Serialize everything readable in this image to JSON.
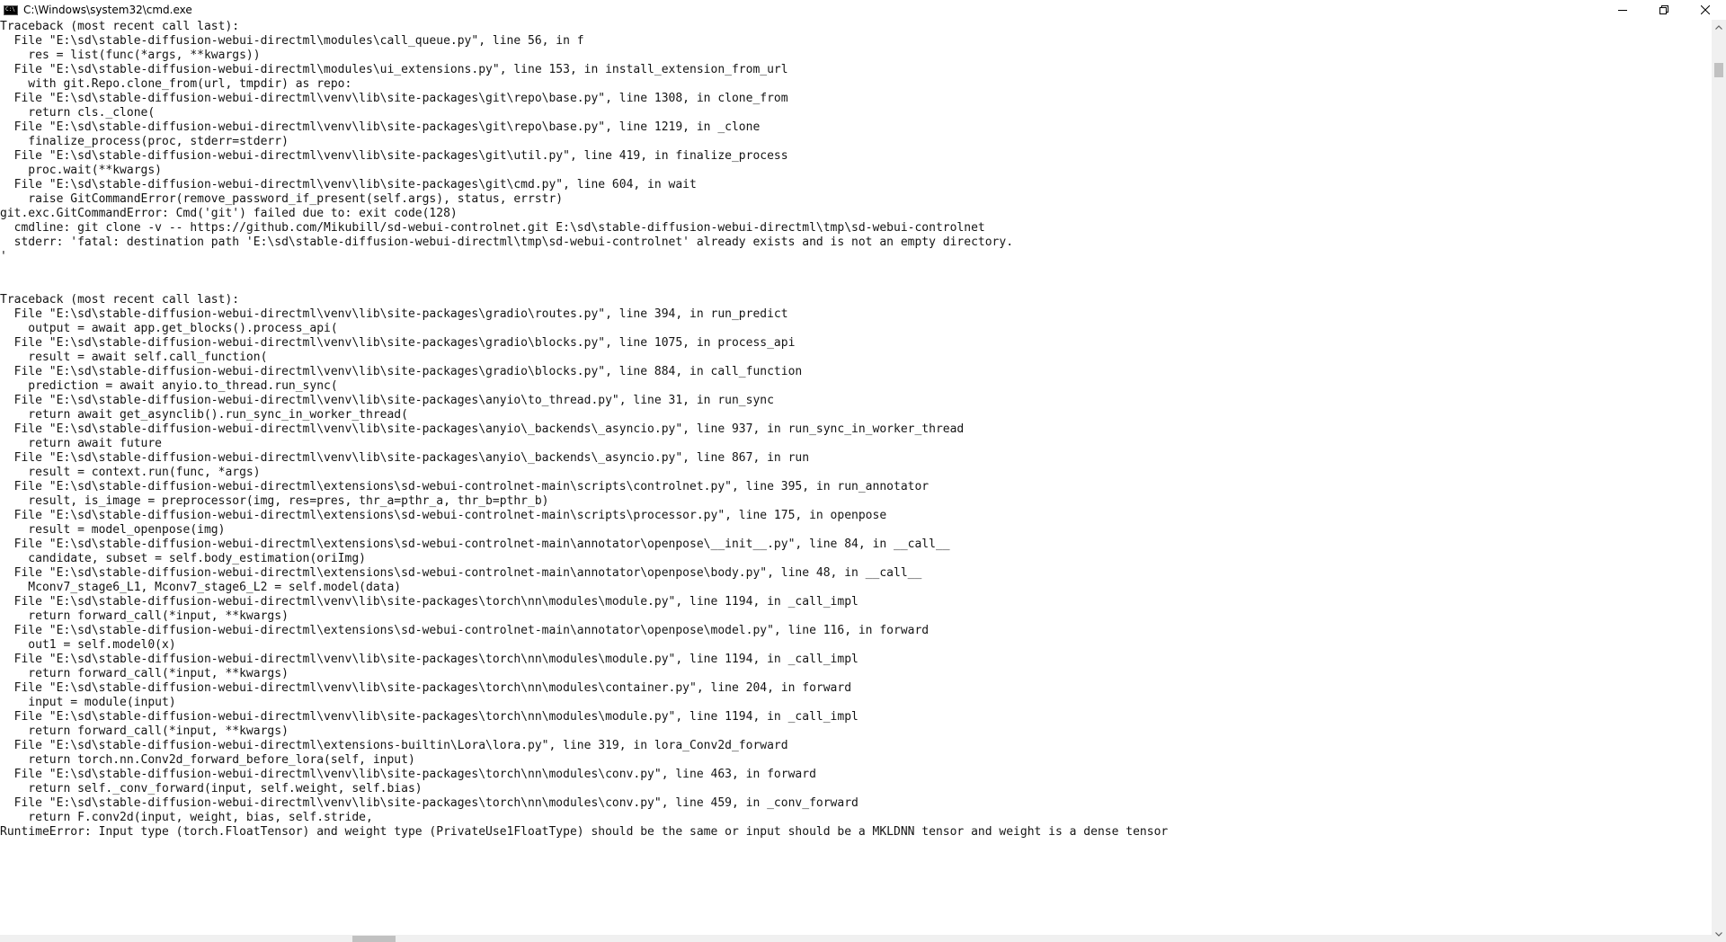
{
  "window": {
    "title": "C:\\Windows\\system32\\cmd.exe",
    "controls": {
      "minimize": "minimize-icon",
      "maximize": "restore-icon",
      "close": "close-icon"
    }
  },
  "colors": {
    "background": "#ffffff",
    "text": "#141414",
    "scrollbar_track": "#f0f0f0",
    "scrollbar_thumb": "#c1c1c1"
  },
  "console": {
    "lines": [
      "Traceback (most recent call last):",
      "  File \"E:\\sd\\stable-diffusion-webui-directml\\modules\\call_queue.py\", line 56, in f",
      "    res = list(func(*args, **kwargs))",
      "  File \"E:\\sd\\stable-diffusion-webui-directml\\modules\\ui_extensions.py\", line 153, in install_extension_from_url",
      "    with git.Repo.clone_from(url, tmpdir) as repo:",
      "  File \"E:\\sd\\stable-diffusion-webui-directml\\venv\\lib\\site-packages\\git\\repo\\base.py\", line 1308, in clone_from",
      "    return cls._clone(",
      "  File \"E:\\sd\\stable-diffusion-webui-directml\\venv\\lib\\site-packages\\git\\repo\\base.py\", line 1219, in _clone",
      "    finalize_process(proc, stderr=stderr)",
      "  File \"E:\\sd\\stable-diffusion-webui-directml\\venv\\lib\\site-packages\\git\\util.py\", line 419, in finalize_process",
      "    proc.wait(**kwargs)",
      "  File \"E:\\sd\\stable-diffusion-webui-directml\\venv\\lib\\site-packages\\git\\cmd.py\", line 604, in wait",
      "    raise GitCommandError(remove_password_if_present(self.args), status, errstr)",
      "git.exc.GitCommandError: Cmd('git') failed due to: exit code(128)",
      "  cmdline: git clone -v -- https://github.com/Mikubill/sd-webui-controlnet.git E:\\sd\\stable-diffusion-webui-directml\\tmp\\sd-webui-controlnet",
      "  stderr: 'fatal: destination path 'E:\\sd\\stable-diffusion-webui-directml\\tmp\\sd-webui-controlnet' already exists and is not an empty directory.",
      "'",
      "",
      "",
      "Traceback (most recent call last):",
      "  File \"E:\\sd\\stable-diffusion-webui-directml\\venv\\lib\\site-packages\\gradio\\routes.py\", line 394, in run_predict",
      "    output = await app.get_blocks().process_api(",
      "  File \"E:\\sd\\stable-diffusion-webui-directml\\venv\\lib\\site-packages\\gradio\\blocks.py\", line 1075, in process_api",
      "    result = await self.call_function(",
      "  File \"E:\\sd\\stable-diffusion-webui-directml\\venv\\lib\\site-packages\\gradio\\blocks.py\", line 884, in call_function",
      "    prediction = await anyio.to_thread.run_sync(",
      "  File \"E:\\sd\\stable-diffusion-webui-directml\\venv\\lib\\site-packages\\anyio\\to_thread.py\", line 31, in run_sync",
      "    return await get_asynclib().run_sync_in_worker_thread(",
      "  File \"E:\\sd\\stable-diffusion-webui-directml\\venv\\lib\\site-packages\\anyio\\_backends\\_asyncio.py\", line 937, in run_sync_in_worker_thread",
      "    return await future",
      "  File \"E:\\sd\\stable-diffusion-webui-directml\\venv\\lib\\site-packages\\anyio\\_backends\\_asyncio.py\", line 867, in run",
      "    result = context.run(func, *args)",
      "  File \"E:\\sd\\stable-diffusion-webui-directml\\extensions\\sd-webui-controlnet-main\\scripts\\controlnet.py\", line 395, in run_annotator",
      "    result, is_image = preprocessor(img, res=pres, thr_a=pthr_a, thr_b=pthr_b)",
      "  File \"E:\\sd\\stable-diffusion-webui-directml\\extensions\\sd-webui-controlnet-main\\scripts\\processor.py\", line 175, in openpose",
      "    result = model_openpose(img)",
      "  File \"E:\\sd\\stable-diffusion-webui-directml\\extensions\\sd-webui-controlnet-main\\annotator\\openpose\\__init__.py\", line 84, in __call__",
      "    candidate, subset = self.body_estimation(oriImg)",
      "  File \"E:\\sd\\stable-diffusion-webui-directml\\extensions\\sd-webui-controlnet-main\\annotator\\openpose\\body.py\", line 48, in __call__",
      "    Mconv7_stage6_L1, Mconv7_stage6_L2 = self.model(data)",
      "  File \"E:\\sd\\stable-diffusion-webui-directml\\venv\\lib\\site-packages\\torch\\nn\\modules\\module.py\", line 1194, in _call_impl",
      "    return forward_call(*input, **kwargs)",
      "  File \"E:\\sd\\stable-diffusion-webui-directml\\extensions\\sd-webui-controlnet-main\\annotator\\openpose\\model.py\", line 116, in forward",
      "    out1 = self.model0(x)",
      "  File \"E:\\sd\\stable-diffusion-webui-directml\\venv\\lib\\site-packages\\torch\\nn\\modules\\module.py\", line 1194, in _call_impl",
      "    return forward_call(*input, **kwargs)",
      "  File \"E:\\sd\\stable-diffusion-webui-directml\\venv\\lib\\site-packages\\torch\\nn\\modules\\container.py\", line 204, in forward",
      "    input = module(input)",
      "  File \"E:\\sd\\stable-diffusion-webui-directml\\venv\\lib\\site-packages\\torch\\nn\\modules\\module.py\", line 1194, in _call_impl",
      "    return forward_call(*input, **kwargs)",
      "  File \"E:\\sd\\stable-diffusion-webui-directml\\extensions-builtin\\Lora\\lora.py\", line 319, in lora_Conv2d_forward",
      "    return torch.nn.Conv2d_forward_before_lora(self, input)",
      "  File \"E:\\sd\\stable-diffusion-webui-directml\\venv\\lib\\site-packages\\torch\\nn\\modules\\conv.py\", line 463, in forward",
      "    return self._conv_forward(input, self.weight, self.bias)",
      "  File \"E:\\sd\\stable-diffusion-webui-directml\\venv\\lib\\site-packages\\torch\\nn\\modules\\conv.py\", line 459, in _conv_forward",
      "    return F.conv2d(input, weight, bias, self.stride,",
      "RuntimeError: Input type (torch.FloatTensor) and weight type (PrivateUse1FloatType) should be the same or input should be a MKLDNN tensor and weight is a dense tensor"
    ]
  }
}
